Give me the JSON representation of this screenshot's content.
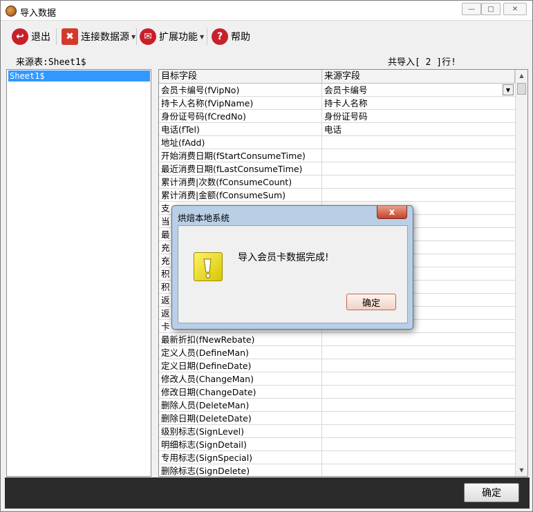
{
  "window": {
    "title": "导入数据"
  },
  "toolbar": {
    "exit_label": "退出",
    "connect_label": "连接数据源",
    "extend_label": "扩展功能",
    "help_label": "帮助"
  },
  "source": {
    "label": "来源表:Sheet1$",
    "count_text": "共导入[ 2 ]行!"
  },
  "sheets": [
    "Sheet1$"
  ],
  "grid": {
    "columns": [
      "目标字段",
      "来源字段"
    ],
    "rows": [
      [
        "会员卡编号(fVipNo)",
        "会员卡编号"
      ],
      [
        "持卡人名称(fVipName)",
        "持卡人名称"
      ],
      [
        "身份证号码(fCredNo)",
        "身份证号码"
      ],
      [
        "电话(fTel)",
        "电话"
      ],
      [
        "地址(fAdd)",
        ""
      ],
      [
        "开始消费日期(fStartConsumeTime)",
        ""
      ],
      [
        "最近消费日期(fLastConsumeTime)",
        ""
      ],
      [
        "累计消费|次数(fConsumeCount)",
        ""
      ],
      [
        "累计消费|金额(fConsumeSum)",
        ""
      ],
      [
        "支",
        ""
      ],
      [
        "当",
        ""
      ],
      [
        "最",
        ""
      ],
      [
        "充",
        ""
      ],
      [
        "充",
        ""
      ],
      [
        "积",
        ""
      ],
      [
        "积",
        ""
      ],
      [
        "返",
        ""
      ],
      [
        "返",
        ""
      ],
      [
        "卡",
        ""
      ],
      [
        "最新折扣(fNewRebate)",
        ""
      ],
      [
        "定义人员(DefineMan)",
        ""
      ],
      [
        "定义日期(DefineDate)",
        ""
      ],
      [
        "修改人员(ChangeMan)",
        ""
      ],
      [
        "修改日期(ChangeDate)",
        ""
      ],
      [
        "删除人员(DeleteMan)",
        ""
      ],
      [
        "删除日期(DeleteDate)",
        ""
      ],
      [
        "级别标志(SignLevel)",
        ""
      ],
      [
        "明细标志(SignDetail)",
        ""
      ],
      [
        "专用标志(SignSpecial)",
        ""
      ],
      [
        "删除标志(SignDelete)",
        ""
      ]
    ]
  },
  "footer": {
    "ok_label": "确定"
  },
  "dialog": {
    "title": "烘焙本地系统",
    "message": "导入会员卡数据完成!",
    "ok_label": "确定",
    "close_glyph": "x"
  },
  "colors": {
    "selection": "#3399ff",
    "dialog_frame": "#b9cfe6",
    "close_red": "#c7412a"
  }
}
